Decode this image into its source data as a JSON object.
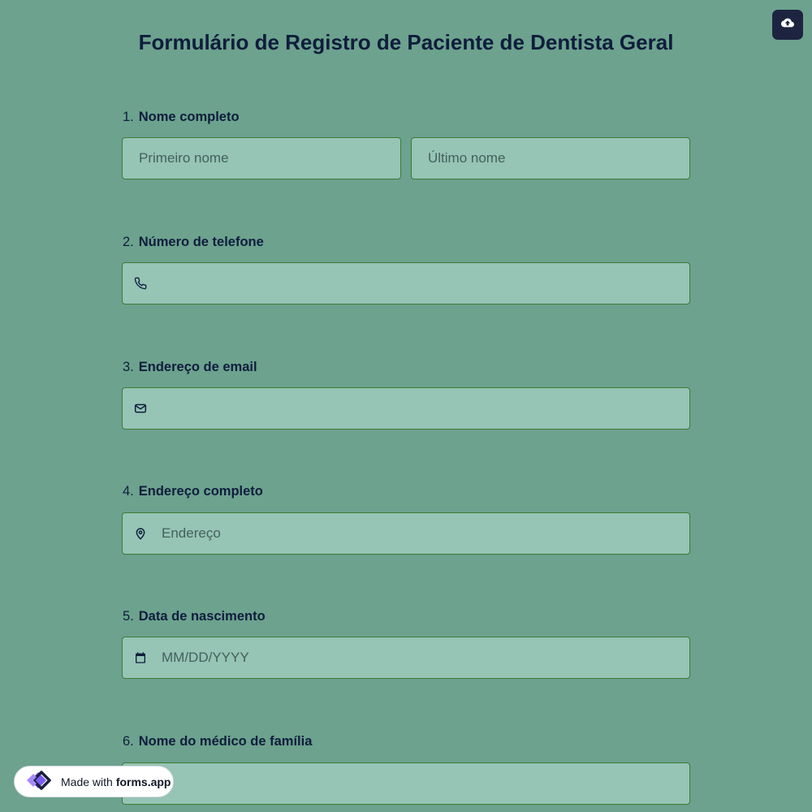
{
  "form": {
    "title": "Formulário de Registro de Paciente de Dentista Geral",
    "questions": [
      {
        "number": "1.",
        "label": "Nome completo",
        "first_placeholder": "Primeiro nome",
        "last_placeholder": "Último nome"
      },
      {
        "number": "2.",
        "label": "Número de telefone",
        "icon": "phone-icon",
        "placeholder": ""
      },
      {
        "number": "3.",
        "label": "Endereço de email",
        "icon": "mail-icon",
        "placeholder": ""
      },
      {
        "number": "4.",
        "label": "Endereço completo",
        "icon": "map-pin-icon",
        "placeholder": "Endereço"
      },
      {
        "number": "5.",
        "label": "Data de nascimento",
        "icon": "calendar-icon",
        "placeholder": "MM/DD/YYYY"
      },
      {
        "number": "6.",
        "label": "Nome do médico de família",
        "placeholder": ""
      }
    ]
  },
  "toolbar": {
    "save_icon": "cloud-upload-icon"
  },
  "badge": {
    "made_with": "Made with",
    "brand": "forms.app"
  },
  "colors": {
    "background": "#6ca28e",
    "field_background": "#96c4b5",
    "field_border": "#3f7a35",
    "text": "#0f1d3c",
    "button": "#1d2440"
  }
}
